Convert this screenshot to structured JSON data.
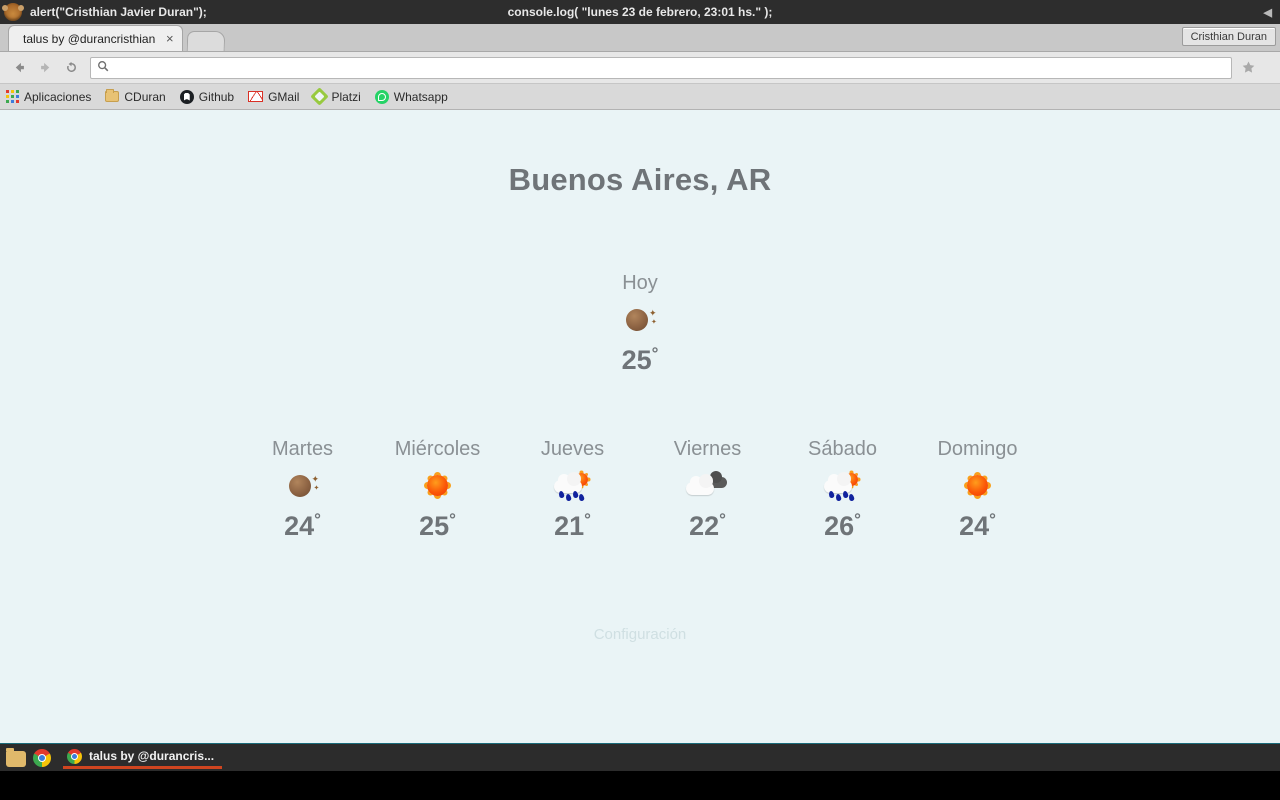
{
  "os_titlebar": {
    "left_text": "alert(\"Cristhian Javier Duran\");",
    "center_text": "console.log( \"lunes 23 de febrero, 23:01 hs.\" );",
    "right_icon": "◀",
    "app_icon": "monkey-icon"
  },
  "browser": {
    "tab": {
      "title": "talus by @durancristhian",
      "close_label": "×"
    },
    "new_tab_label": "",
    "user_badge": "Cristhian Duran",
    "toolbar": {
      "back_icon": "←",
      "forward_icon": "→",
      "reload_icon": "⟳",
      "omnibox_value": "",
      "omnibox_placeholder": "",
      "search_icon": "⌕",
      "star_icon": "★",
      "menu_icon": "≡"
    },
    "bookmarks": [
      {
        "label": "Aplicaciones",
        "icon": "apps-grid-icon"
      },
      {
        "label": "CDuran",
        "icon": "folder-icon"
      },
      {
        "label": "Github",
        "icon": "github-icon"
      },
      {
        "label": "GMail",
        "icon": "gmail-icon"
      },
      {
        "label": "Platzi",
        "icon": "platzi-icon"
      },
      {
        "label": "Whatsapp",
        "icon": "whatsapp-icon"
      }
    ]
  },
  "app": {
    "city": "Buenos Aires, AR",
    "today": {
      "label": "Hoy",
      "icon": "moon-stars-icon",
      "temp": "25",
      "degree": "°"
    },
    "forecast": [
      {
        "label": "Martes",
        "icon": "moon-stars-icon",
        "temp": "24",
        "degree": "°"
      },
      {
        "label": "Miércoles",
        "icon": "sun-icon",
        "temp": "25",
        "degree": "°"
      },
      {
        "label": "Jueves",
        "icon": "rain-sun-icon",
        "temp": "21",
        "degree": "°"
      },
      {
        "label": "Viernes",
        "icon": "clouds-icon",
        "temp": "22",
        "degree": "°"
      },
      {
        "label": "Sábado",
        "icon": "rain-sun-icon",
        "temp": "26",
        "degree": "°"
      },
      {
        "label": "Domingo",
        "icon": "sun-icon",
        "temp": "24",
        "degree": "°"
      }
    ],
    "settings_link": "Configuración",
    "colors": {
      "background": "#eaf4f6",
      "text": "#6f7478",
      "muted_text": "#8a9094",
      "link": "#cfdfe2"
    }
  },
  "taskbar": {
    "launchers": [
      {
        "icon": "folder-icon"
      },
      {
        "icon": "chrome-icon"
      }
    ],
    "active_window": {
      "icon": "chrome-icon",
      "title": "talus by @durancris...",
      "accent": "#cf4520"
    }
  }
}
